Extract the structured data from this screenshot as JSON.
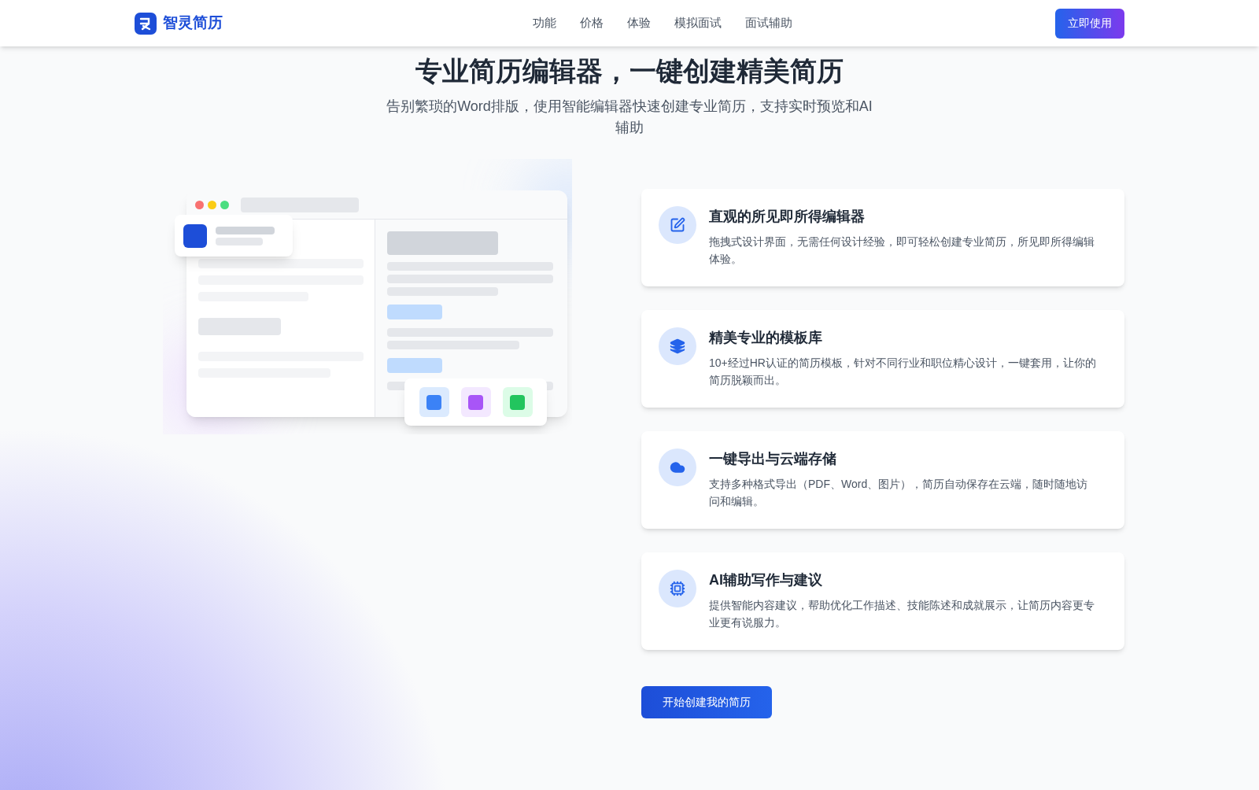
{
  "header": {
    "logo_text": "智灵简历",
    "nav": [
      {
        "label": "功能"
      },
      {
        "label": "价格"
      },
      {
        "label": "体验"
      },
      {
        "label": "模拟面试"
      },
      {
        "label": "面试辅助"
      }
    ],
    "cta": "立即使用"
  },
  "hero": {
    "title": "专业简历编辑器，一键创建精美简历",
    "subtitle": "告别繁琐的Word排版，使用智能编辑器快速创建专业简历，支持实时预览和AI辅助"
  },
  "features": [
    {
      "kind": "edit",
      "title": "直观的所见即所得编辑器",
      "description": "拖拽式设计界面，无需任何设计经验，即可轻松创建专业简历，所见即所得编辑体验。"
    },
    {
      "kind": "layers",
      "title": "精美专业的模板库",
      "description": "10+经过HR认证的简历模板，针对不同行业和职位精心设计，一键套用，让你的简历脱颖而出。"
    },
    {
      "kind": "cloud",
      "title": "一键导出与云端存储",
      "description": "支持多种格式导出（PDF、Word、图片），简历自动保存在云端，随时随地访问和编辑。"
    },
    {
      "kind": "chip",
      "title": "AI辅助写作与建议",
      "description": "提供智能内容建议，帮助优化工作描述、技能陈述和成就展示，让简历内容更专业更有说服力。"
    }
  ],
  "start_button": "开始创建我的简历"
}
